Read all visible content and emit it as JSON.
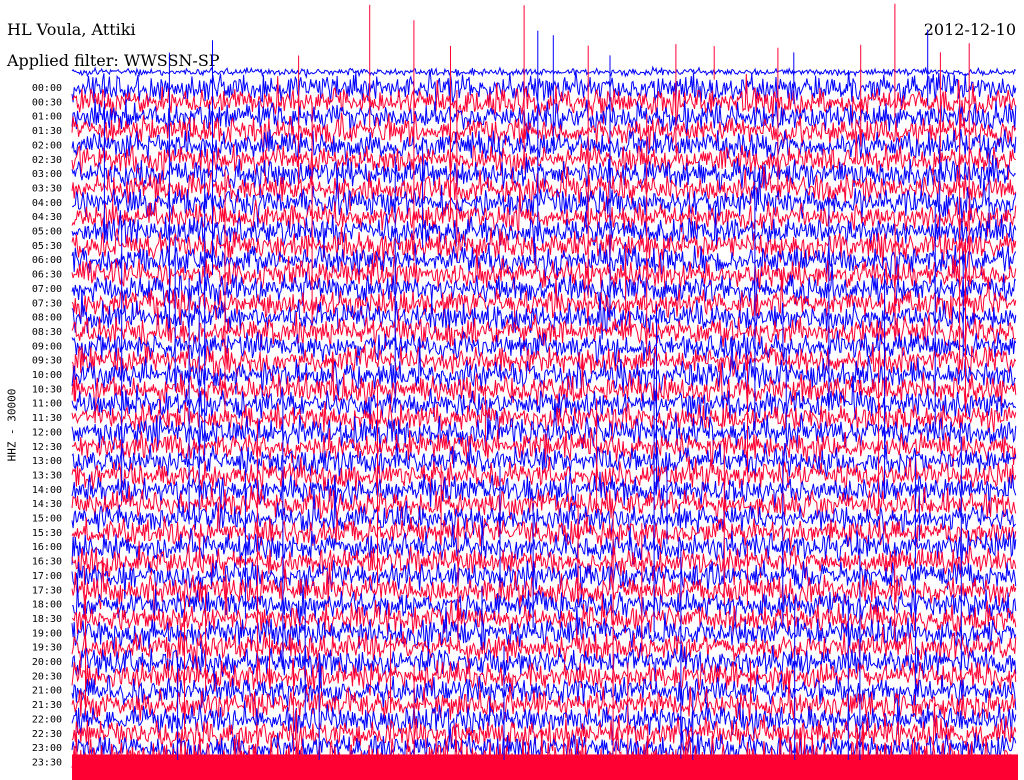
{
  "header": {
    "station": "HL Voula, Attiki",
    "filter": "Applied filter: WWSSN-SP",
    "date": "2012-12-10"
  },
  "chart_data": {
    "type": "line",
    "title": "HL Voula, Attiki",
    "subtitle": "Applied filter: WWSSN-SP",
    "date": "2012-12-10",
    "ylabel": "HHZ - 30000",
    "xlabel": "",
    "row_labels": [
      "00:00",
      "00:30",
      "01:00",
      "01:30",
      "02:00",
      "02:30",
      "03:00",
      "03:30",
      "04:00",
      "04:30",
      "05:00",
      "05:30",
      "06:00",
      "06:30",
      "07:00",
      "07:30",
      "08:00",
      "08:30",
      "09:00",
      "09:30",
      "10:00",
      "10:30",
      "11:00",
      "11:30",
      "12:00",
      "12:30",
      "13:00",
      "13:30",
      "14:00",
      "14:30",
      "15:00",
      "15:30",
      "16:00",
      "16:30",
      "17:00",
      "17:30",
      "18:00",
      "18:30",
      "19:00",
      "19:30",
      "20:00",
      "20:30",
      "21:00",
      "21:30",
      "22:00",
      "22:30",
      "23:00",
      "23:30"
    ],
    "colors": [
      "#0000ff",
      "#ff0033"
    ],
    "grid": false,
    "legend": "none"
  }
}
